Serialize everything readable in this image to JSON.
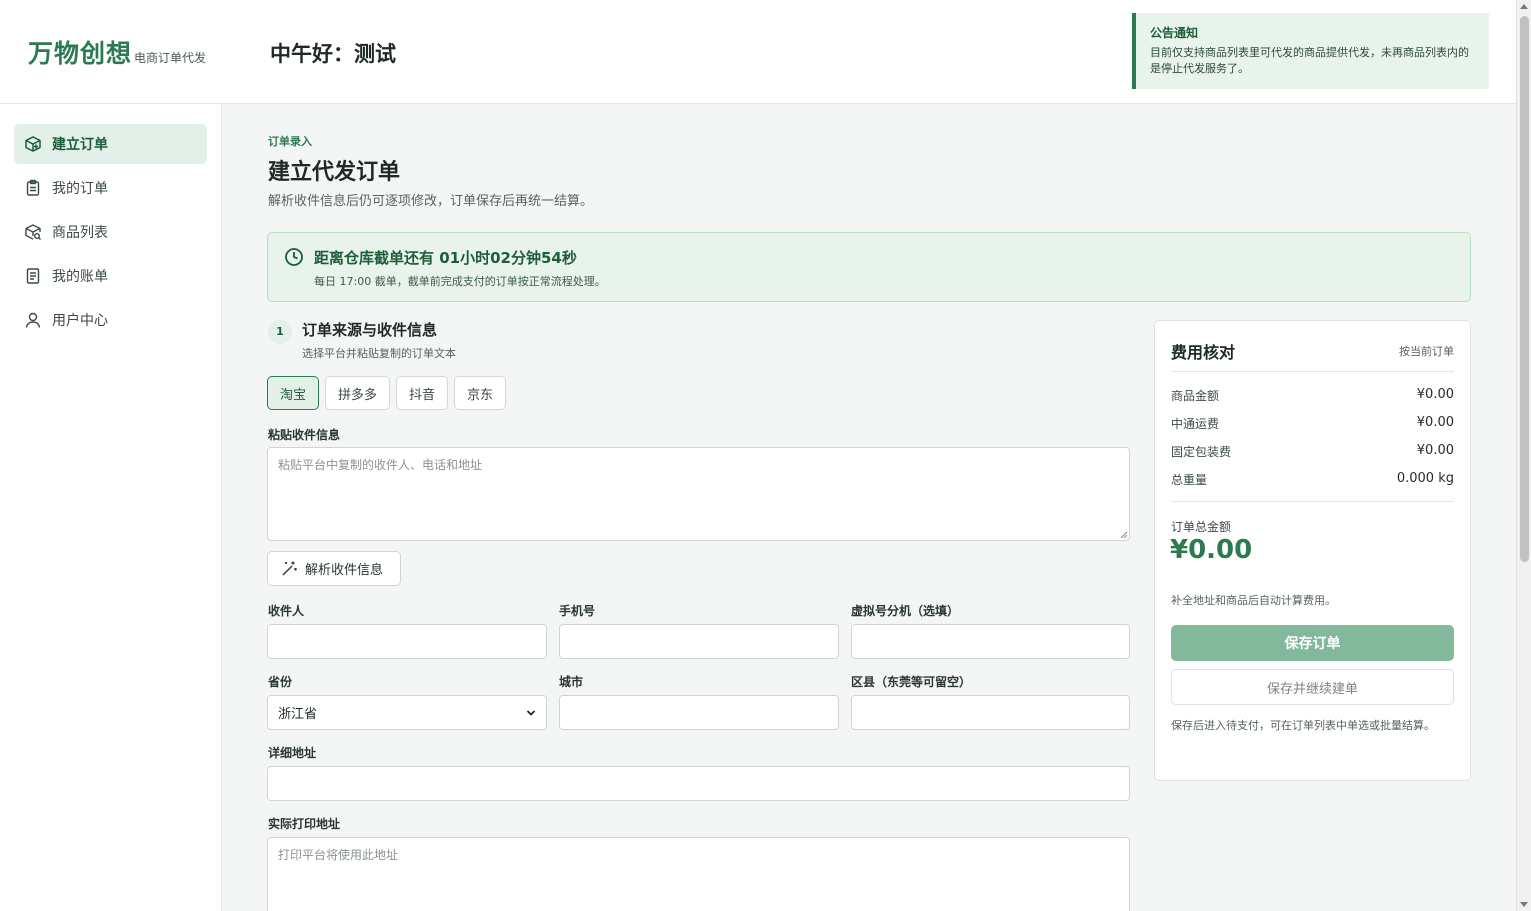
{
  "header": {
    "brand": "万物创想",
    "brand_sub": "电商订单代发",
    "greeting": "中午好：测试",
    "notice": {
      "title": "公告通知",
      "text": "目前仅支持商品列表里可代发的商品提供代发，未再商品列表内的是停止代发服务了。"
    }
  },
  "sidebar": {
    "items": [
      {
        "label": "建立订单",
        "icon": "box-plus-icon",
        "active": true
      },
      {
        "label": "我的订单",
        "icon": "clipboard-icon",
        "active": false
      },
      {
        "label": "商品列表",
        "icon": "box-search-icon",
        "active": false
      },
      {
        "label": "我的账单",
        "icon": "document-icon",
        "active": false
      },
      {
        "label": "用户中心",
        "icon": "user-icon",
        "active": false
      }
    ]
  },
  "page": {
    "eyebrow": "订单录入",
    "title": "建立代发订单",
    "desc": "解析收件信息后仍可逐项修改，订单保存后再统一结算。"
  },
  "countdown": {
    "title": "距离仓库截单还有 01小时02分钟54秒",
    "sub": "每日 17:00 截单，截单前完成支付的订单按正常流程处理。"
  },
  "step": {
    "number": "1",
    "title": "订单来源与收件信息",
    "sub": "选择平台并粘贴复制的订单文本"
  },
  "platforms": [
    {
      "label": "淘宝",
      "active": true
    },
    {
      "label": "拼多多",
      "active": false
    },
    {
      "label": "抖音",
      "active": false
    },
    {
      "label": "京东",
      "active": false
    }
  ],
  "form": {
    "paste_label": "粘贴收件信息",
    "paste_placeholder": "粘贴平台中复制的收件人、电话和地址",
    "parse_button": "解析收件信息",
    "recipient_label": "收件人",
    "phone_label": "手机号",
    "ext_label": "虚拟号分机（选填）",
    "province_label": "省份",
    "province_value": "浙江省",
    "city_label": "城市",
    "district_label": "区县（东莞等可留空）",
    "address_label": "详细地址",
    "print_label": "实际打印地址",
    "print_placeholder": "打印平台将使用此地址"
  },
  "fees": {
    "title": "费用核对",
    "note": "按当前订单",
    "rows": [
      {
        "label": "商品金额",
        "value": "¥0.00"
      },
      {
        "label": "中通运费",
        "value": "¥0.00"
      },
      {
        "label": "固定包装费",
        "value": "¥0.00"
      },
      {
        "label": "总重量",
        "value": "0.000 kg"
      }
    ],
    "total_label": "订单总金额",
    "total_value": "¥0.00",
    "hint": "补全地址和商品后自动计算费用。",
    "save_button": "保存订单",
    "save_continue_button": "保存并继续建单",
    "footer": "保存后进入待支付，可在订单列表中单选或批量结算。"
  },
  "colors": {
    "accent": "#2c7a4f",
    "accent_light": "#e2f0e7",
    "save_button_bg": "#83b89a"
  }
}
